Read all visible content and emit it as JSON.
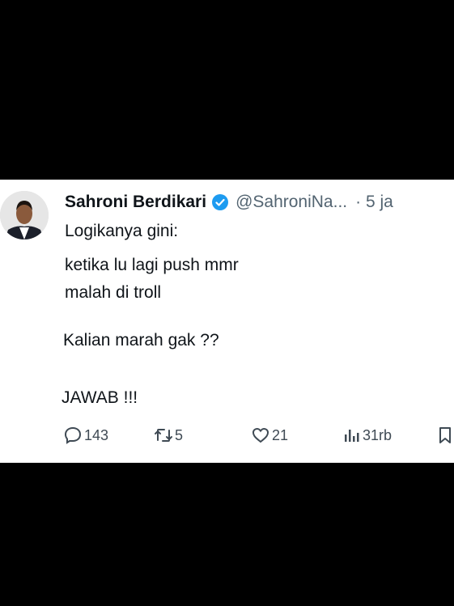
{
  "tweet": {
    "author_name": "Sahroni Berdikari",
    "handle": "@SahroniNa...",
    "time": "· 5 ja",
    "lines": [
      "Logikanya gini:",
      "ketika lu lagi push mmr",
      "malah di troll",
      "Kalian marah gak ??",
      "JAWAB !!!"
    ],
    "stats": {
      "replies": "143",
      "retweets": "5",
      "likes": "21",
      "views": "31rb"
    }
  },
  "colors": {
    "verified": "#1d9bf0",
    "text": "#0f1419",
    "muted": "#536471",
    "background": "#000000",
    "card": "#ffffff"
  },
  "icons": [
    "reply-icon",
    "retweet-icon",
    "like-icon",
    "views-icon",
    "bookmark-icon",
    "verified-badge-icon"
  ]
}
